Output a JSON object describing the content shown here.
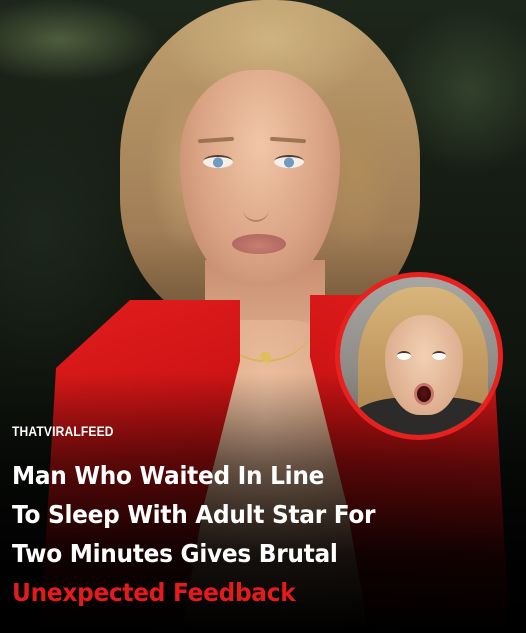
{
  "post": {
    "brand": "THATVIRALFEED",
    "headline": {
      "line1": "Man Who Waited In Line",
      "line2": "To Sleep With Adult Star For",
      "line3": "Two Minutes Gives Brutal",
      "line4": "Unexpected Feedback"
    }
  },
  "colors": {
    "accent_red": "#e21b1b",
    "headline_white": "#ffffff",
    "inset_border": "#e8211f"
  }
}
